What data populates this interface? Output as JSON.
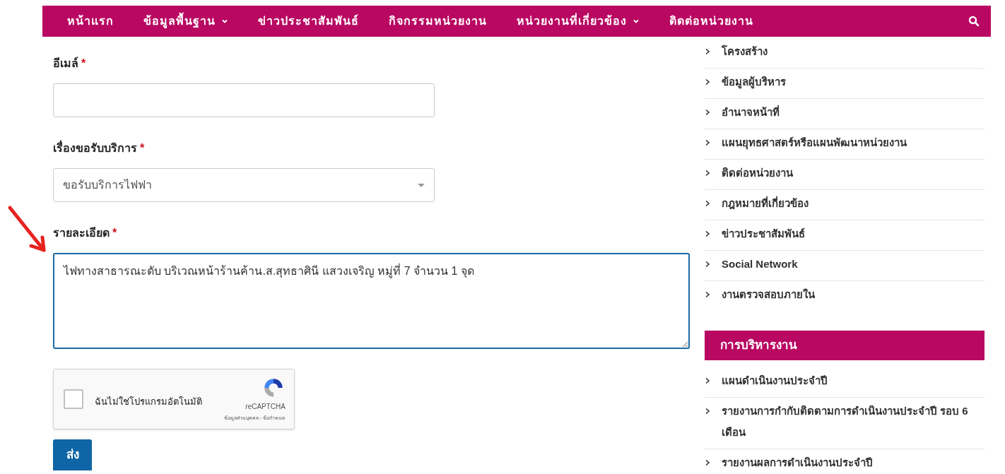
{
  "nav": {
    "items": [
      {
        "label": "หน้าแรก",
        "dropdown": false
      },
      {
        "label": "ข้อมูลพื้นฐาน",
        "dropdown": true
      },
      {
        "label": "ข่าวประชาสัมพันธ์",
        "dropdown": false
      },
      {
        "label": "กิจกรรมหน่วยงาน",
        "dropdown": false
      },
      {
        "label": "หน่วยงานที่เกี่ยวข้อง",
        "dropdown": true
      },
      {
        "label": "ติดต่อหน่วยงาน",
        "dropdown": false
      }
    ]
  },
  "form": {
    "fields": [
      {
        "kind": "input",
        "label": "อีเมล์",
        "required": "*"
      },
      {
        "kind": "select",
        "label": "เรื่องขอรับบริการ",
        "required": "*",
        "value": "ขอรับบริการไฟฟา"
      },
      {
        "kind": "textarea",
        "label": "รายละเอียด",
        "required": "*",
        "value": "ไฟทางสาธารณะดับ บริเวณหน้าร้านค้าน.ส.สุทธาศินี แสวงเจริญ หมู่ที่ 7 จำนวน 1 จุด",
        "focused": true
      }
    ],
    "captcha": {
      "checked": false,
      "label": "ฉันไม่ใช่โปรแกรมอัตโนมัติ",
      "brand": "reCAPTCHA",
      "links": "ข้อมูลส่วนบุคคล - ข้อกำหนด"
    },
    "submit": "ส่ง"
  },
  "sidebar": {
    "items": [
      {
        "label": "โครงสร้าง"
      },
      {
        "label": "ข้อมูลผู้บริหาร"
      },
      {
        "label": "อำนาจหน้าที่"
      },
      {
        "label": "แผนยุทธศาสตร์หรือแผนพัฒนาหน่วยงาน"
      },
      {
        "label": "ติดต่อหน่วยงาน"
      },
      {
        "label": "กฎหมายที่เกี่ยวข้อง"
      },
      {
        "label": "ข่าวประชาสัมพันธ์"
      },
      {
        "label": "Social Network"
      },
      {
        "label": "งานตรวจสอบภายใน"
      }
    ],
    "section": {
      "title": "การบริหารงาน",
      "items": [
        {
          "label": "แผนดำเนินงานประจำปี"
        },
        {
          "label": "รายงานการกำกับติดตามการดำเนินงานประจำปี รอบ 6 เดือน"
        },
        {
          "label": "รายงานผลการดำเนินงานประจำปี"
        }
      ]
    }
  }
}
